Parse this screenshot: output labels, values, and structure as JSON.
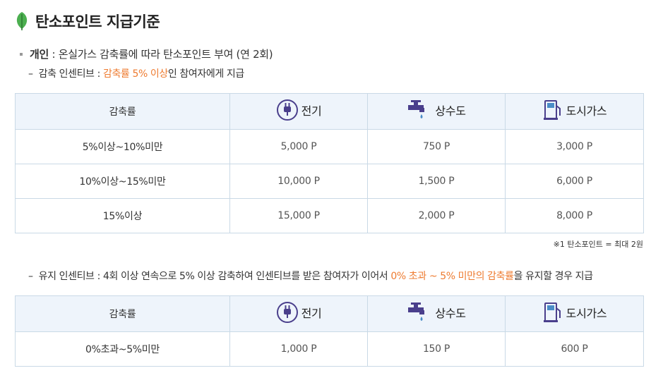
{
  "title": "탄소포인트 지급기준",
  "bullet": {
    "label": "개인",
    "text": " : 온실가스 감축률에 따라 탄소포인트 부여 (연 2회)"
  },
  "incentive1": {
    "dash": "–",
    "prefix": "감축 인센티브 : ",
    "highlight": "감축률 5% 이상",
    "suffix": "인 참여자에게 지급"
  },
  "table1": {
    "headers": [
      "감축률",
      "전기",
      "상수도",
      "도시가스"
    ],
    "rows": [
      [
        "5%이상~10%미만",
        "5,000 P",
        "750 P",
        "3,000 P"
      ],
      [
        "10%이상~15%미만",
        "10,000 P",
        "1,500 P",
        "6,000 P"
      ],
      [
        "15%이상",
        "15,000 P",
        "2,000 P",
        "8,000 P"
      ]
    ]
  },
  "note": "※1 탄소포인트 = 최대 2원",
  "incentive2": {
    "dash": "–",
    "prefix": "유지 인센티브 : 4회 이상 연속으로 5% 이상 감축하여 인센티브를 받은 참여자가 이어서 ",
    "highlight": "0% 초과 ~ 5% 미만의 감축률",
    "suffix": "을 유지할 경우 지급"
  },
  "table2": {
    "headers": [
      "감축률",
      "전기",
      "상수도",
      "도시가스"
    ],
    "rows": [
      [
        "0%초과~5%미만",
        "1,000 P",
        "150 P",
        "600 P"
      ]
    ]
  },
  "icons": {
    "title": "leaf-icon",
    "electricity": "plug-icon",
    "water": "faucet-icon",
    "gas": "gas-pump-icon"
  },
  "colors": {
    "highlight": "#ee7b30",
    "header_bg": "#eef4fb",
    "border": "#c9d9e6",
    "leaf": "#4caf50",
    "icon_purple": "#4a3f8c",
    "icon_blue": "#4a8cc7"
  }
}
